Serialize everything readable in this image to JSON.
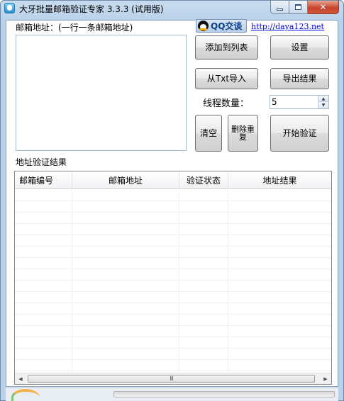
{
  "window": {
    "title": "大牙批量邮箱验证专家 3.3.3 (试用版)",
    "accent_color": "#b9d1ea",
    "caption_buttons": [
      "minimize-icon",
      "maximize-icon",
      "close-icon"
    ]
  },
  "email_input": {
    "label": "邮箱地址：(一行一条邮箱地址)",
    "value": ""
  },
  "contact": {
    "qq_label": "QQ交谈",
    "qq_icon": "qq-penguin-icon",
    "site_url": "http://daya123.net"
  },
  "buttons": {
    "add_to_list": "添加到列表",
    "settings": "设置",
    "import_txt": "从Txt导入",
    "export_results": "导出结果",
    "clear": "清空",
    "remove_duplicates": "删除重复",
    "start_verify": "开始验证"
  },
  "threads": {
    "label": "线程数量：",
    "value": "5"
  },
  "results": {
    "label": "地址验证结果",
    "columns": [
      "邮箱编号",
      "邮箱地址",
      "验证状态",
      "地址结果"
    ],
    "rows": []
  },
  "scrollbar": {
    "thumb_grip": "Ⅲ"
  }
}
